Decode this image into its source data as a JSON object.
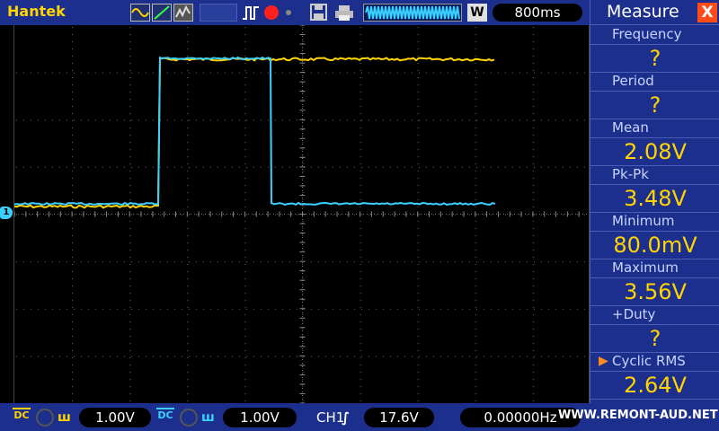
{
  "brand": "Hantek",
  "icons": {
    "wave_icons": [
      "sine-wave-icon",
      "ramp-icon",
      "noise-icon"
    ],
    "pulse": "pulse-icon",
    "record": "record-icon",
    "save": "save-icon",
    "print": "print-icon"
  },
  "timebase": {
    "w_label": "W",
    "value": "800ms"
  },
  "measure": {
    "title": "Measure",
    "close": "X",
    "items": [
      {
        "label": "Frequency",
        "value": "?"
      },
      {
        "label": "Period",
        "value": "?"
      },
      {
        "label": "Mean",
        "value": "2.08V"
      },
      {
        "label": "Pk-Pk",
        "value": "3.48V"
      },
      {
        "label": "Minimum",
        "value": "80.0mV"
      },
      {
        "label": "Maximum",
        "value": "3.56V"
      },
      {
        "label": "+Duty",
        "value": "?"
      },
      {
        "label": "Cyclic RMS",
        "value": "2.64V"
      }
    ],
    "selected_marker": "▶"
  },
  "ch1": {
    "coupling": "DC",
    "volts_div": "1.00V",
    "color": "#ffd400"
  },
  "ch2": {
    "coupling": "DC",
    "volts_div": "1.00V",
    "color": "#3ad0ff"
  },
  "trigger": {
    "source": "CH1",
    "edge_symbol": "∫",
    "level": "17.6V"
  },
  "frequency_counter": "0.00000Hz",
  "watermark": "WWW.REMONT-AUD.NET",
  "ground_marker": "1"
}
